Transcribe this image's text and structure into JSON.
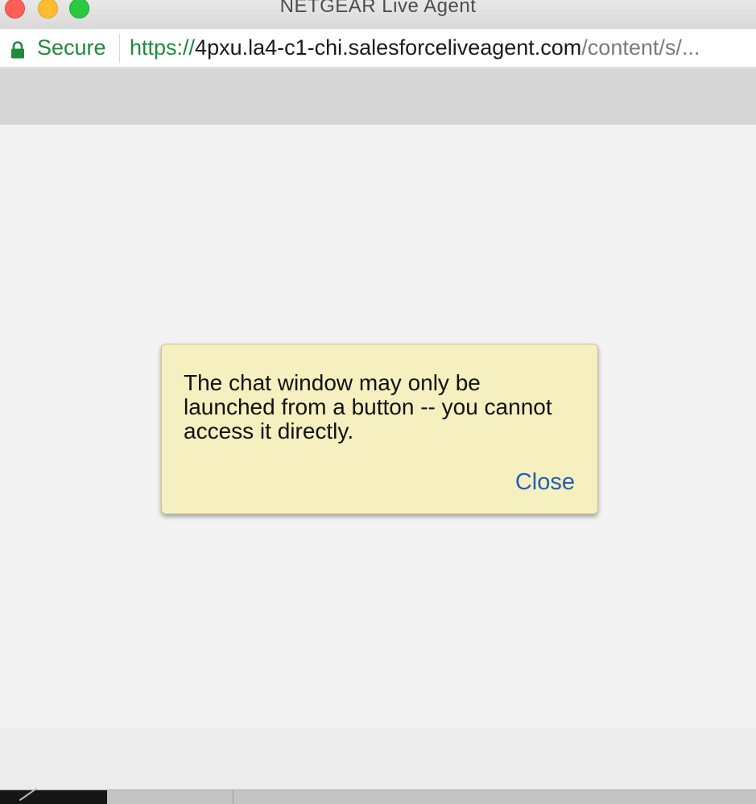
{
  "window": {
    "title": "NETGEAR Live Agent"
  },
  "addressbar": {
    "secure_label": "Secure",
    "url_scheme": "https://",
    "url_host": "4pxu.la4-c1-chi.salesforceliveagent.com",
    "url_path": "/content/s/..."
  },
  "dialog": {
    "message": "The chat window may only be launched from a button -- you cannot access it directly.",
    "close_label": "Close"
  },
  "icons": {
    "lock": "lock-icon",
    "close_window": "close-window-icon",
    "minimize_window": "minimize-window-icon",
    "zoom_window": "zoom-window-icon"
  },
  "colors": {
    "secure_green": "#1e8a3a",
    "dialog_bg": "#f6efbf",
    "link_blue": "#1f5fb8"
  }
}
